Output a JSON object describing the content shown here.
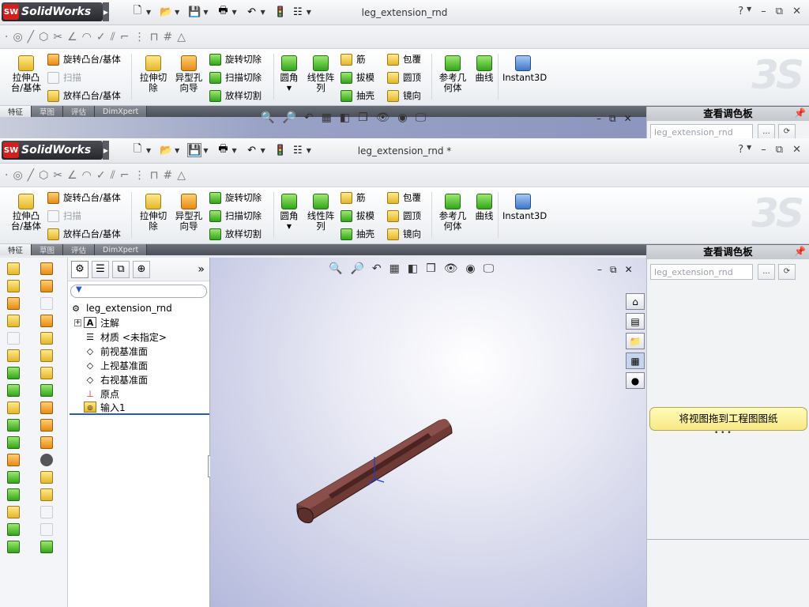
{
  "app_name": "SolidWorks",
  "sw_badge": "SW",
  "windows": [
    {
      "title": "leg_extension_rnd"
    },
    {
      "title": "leg_extension_rnd *"
    }
  ],
  "window_controls": {
    "help": "?",
    "minimize": "–",
    "restore": "⧉",
    "close": "✕"
  },
  "ribbon": {
    "extrude_boss": "拉伸凸\n台/基体",
    "revolve_boss": "旋转凸台/基体",
    "sweep": "扫描",
    "loft_boss": "放样凸台/基体",
    "extrude_cut": "拉伸切\n除",
    "hole_wizard": "异型孔\n向导",
    "revolve_cut": "旋转切除",
    "sweep_cut": "扫描切除",
    "loft_cut": "放样切割",
    "fillet": "圆角",
    "linear_pattern": "线性阵\n列",
    "rib": "筋",
    "draft": "拔模",
    "shell": "抽壳",
    "wrap": "包覆",
    "dome": "圆顶",
    "mirror": "镜向",
    "ref_geometry": "参考几\n何体",
    "curves": "曲线",
    "instant3d": "Instant3D"
  },
  "tabs": [
    {
      "label": "特征",
      "active": true
    },
    {
      "label": "草图",
      "active": false
    },
    {
      "label": "评估",
      "active": false
    },
    {
      "label": "DimXpert",
      "active": false
    }
  ],
  "right_panel": {
    "title": "查看调色板",
    "combo_value": "leg_extension_rnd",
    "browse_label": "...",
    "banner": "将视图拖到工程图图纸"
  },
  "feature_tree": {
    "expand_label": "»",
    "items": [
      {
        "label": "leg_extension_rnd",
        "icon": "part-icon"
      },
      {
        "label": "注解",
        "icon": "annotations-icon"
      },
      {
        "label": "材质 <未指定>",
        "icon": "material-icon"
      },
      {
        "label": "前视基准面",
        "icon": "plane-icon"
      },
      {
        "label": "上视基准面",
        "icon": "plane-icon"
      },
      {
        "label": "右视基准面",
        "icon": "plane-icon"
      },
      {
        "label": "原点",
        "icon": "origin-icon"
      },
      {
        "label": "输入1",
        "icon": "imported-body-icon"
      }
    ]
  },
  "colors": {
    "model": "#6e3a36",
    "accent": "#2a5bb8",
    "banner": "#f8e985"
  }
}
